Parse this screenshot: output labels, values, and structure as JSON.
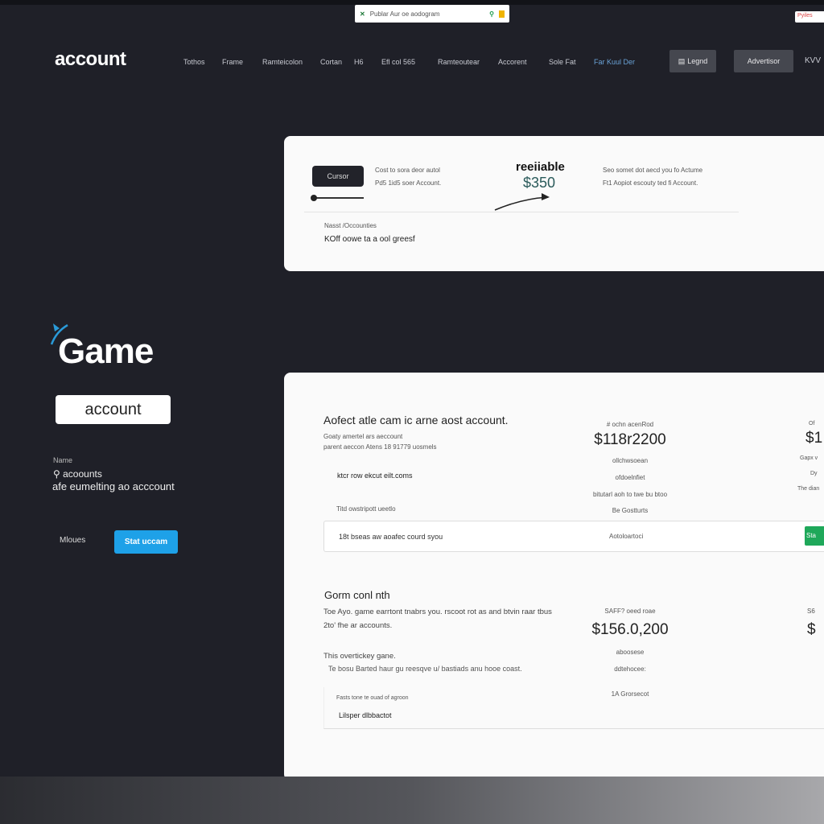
{
  "browser": {
    "search_text": "Publar Aur oe aodogram",
    "corner_label": "Pyiles"
  },
  "header": {
    "logo": "account",
    "nav": [
      "Tothos",
      "Frame",
      "Ramteicolon",
      "Cortan",
      "H6",
      "Efl col 565",
      "Ramteoutear",
      "Accorent",
      "Sole Fat",
      "Far Kuul Der"
    ],
    "login_label": "Legnd",
    "action_label": "Advertisor",
    "extra": "KVV"
  },
  "sidebar": {
    "brand": "Game",
    "account_button": "account",
    "caption": "Name",
    "search_label": "acoounts",
    "description": "afe eumelting ao acccount",
    "more_label": "Mloues",
    "cta_label": "Stat uccam",
    "accent": "#1ea1e8"
  },
  "top_card": {
    "button_label": "Cursor",
    "text_line1": "Cost to sora deor autol",
    "text_line2": "Pd5 1id5 soer Account.",
    "title": "reeiiable",
    "price": "$350",
    "right_line1": "Seo somet dot aecd you fo Actume",
    "right_line2": "Ft1 Aopiot escouty ted fi Account.",
    "footer_label": "Nasst /Occounties",
    "footer_text": "KOff oowe ta a ool greesf"
  },
  "plan_card": {
    "heading": "Aofect atle cam ic arne aost account.",
    "sub1": "Goaty amertel ars aeccount",
    "sub2": "parent aeccon Atens 18 91779 uosmels",
    "bullet": "ktcr row ekcut eilt.coms",
    "note": "Titd owstripott ueetlo",
    "col1": {
      "label": "# ochn acenRod",
      "price": "$118r2200",
      "l1": "ollchwsoean",
      "l2": "ofdoelnfiet",
      "l3": "bitutarl aoh to twe bu btoo",
      "l4": "Be Gostturts"
    },
    "col2": {
      "label": "Of",
      "price": "$1",
      "l1": "Gapx v",
      "l2": "Dy",
      "l3": "The dian"
    },
    "row_text": "18t bseas aw aoafec courd syou",
    "row_mid": "Aotoloartoci",
    "row_button": "Sta",
    "row_button_color": "#1fa85a",
    "heading2": "Gorm conl nth",
    "desc1": "Toe Ayo. game earrtont tnabrs you. rscoot rot as and btvin raar tbus",
    "desc2": "2to' fhe ar accounts.",
    "sub3": "This overtickey gane.",
    "sub4": "Te bosu Barted haur gu reesqve u/ bastiads anu hooe coast.",
    "col3": {
      "label": "SAFF? oeed roae",
      "price": "$156.0,200",
      "l1": "aboosese",
      "l2": "ddtehocee:",
      "l3": "1A Grorsecot"
    },
    "col4": {
      "label": "S6",
      "price": "$"
    },
    "box_label": "Fasts tone te ouad of agroon",
    "box_text": "Lilsper dlbbactot"
  }
}
